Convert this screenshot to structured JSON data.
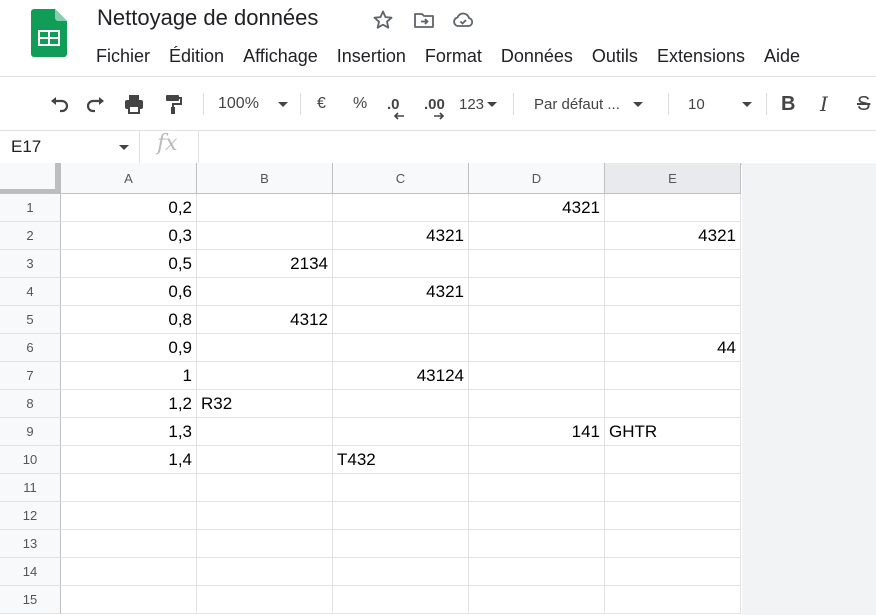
{
  "app": {
    "title": "Nettoyage de données",
    "menu": [
      "Fichier",
      "Édition",
      "Affichage",
      "Insertion",
      "Format",
      "Données",
      "Outils",
      "Extensions",
      "Aide"
    ]
  },
  "toolbar": {
    "zoom": "100%",
    "currency": "€",
    "percent": "%",
    "dec_decrease": ".0",
    "dec_increase": ".00",
    "number_format": "123",
    "font": "Par défaut ...",
    "font_size": "10",
    "bold": "B",
    "italic": "I",
    "strike": "S"
  },
  "formula_bar": {
    "name_box": "E17",
    "fx": "fx",
    "content": ""
  },
  "sheet": {
    "selected_column": "E",
    "columns": [
      "A",
      "B",
      "C",
      "D",
      "E"
    ],
    "rows": [
      "1",
      "2",
      "3",
      "4",
      "5",
      "6",
      "7",
      "8",
      "9",
      "10",
      "11",
      "12",
      "13",
      "14",
      "15"
    ],
    "cells": [
      {
        "row": 1,
        "col": "A",
        "value": "0,2",
        "type": "num"
      },
      {
        "row": 1,
        "col": "D",
        "value": "4321",
        "type": "num"
      },
      {
        "row": 2,
        "col": "A",
        "value": "0,3",
        "type": "num"
      },
      {
        "row": 2,
        "col": "C",
        "value": "4321",
        "type": "num"
      },
      {
        "row": 2,
        "col": "E",
        "value": "4321",
        "type": "num"
      },
      {
        "row": 3,
        "col": "A",
        "value": "0,5",
        "type": "num"
      },
      {
        "row": 3,
        "col": "B",
        "value": "2134",
        "type": "num"
      },
      {
        "row": 4,
        "col": "A",
        "value": "0,6",
        "type": "num"
      },
      {
        "row": 4,
        "col": "C",
        "value": "4321",
        "type": "num"
      },
      {
        "row": 5,
        "col": "A",
        "value": "0,8",
        "type": "num"
      },
      {
        "row": 5,
        "col": "B",
        "value": "4312",
        "type": "num"
      },
      {
        "row": 6,
        "col": "A",
        "value": "0,9",
        "type": "num"
      },
      {
        "row": 6,
        "col": "E",
        "value": "44",
        "type": "num"
      },
      {
        "row": 7,
        "col": "A",
        "value": "1",
        "type": "num"
      },
      {
        "row": 7,
        "col": "C",
        "value": "43124",
        "type": "num"
      },
      {
        "row": 8,
        "col": "A",
        "value": "1,2",
        "type": "num"
      },
      {
        "row": 8,
        "col": "B",
        "value": "R32",
        "type": "txt"
      },
      {
        "row": 9,
        "col": "A",
        "value": "1,3",
        "type": "num"
      },
      {
        "row": 9,
        "col": "D",
        "value": "141",
        "type": "num"
      },
      {
        "row": 9,
        "col": "E",
        "value": "GHTR",
        "type": "txt"
      },
      {
        "row": 10,
        "col": "A",
        "value": "1,4",
        "type": "num"
      },
      {
        "row": 10,
        "col": "C",
        "value": "T432",
        "type": "txt"
      }
    ]
  },
  "colors": {
    "brand_green": "#0f9d58",
    "header_bg": "#f8f9fa",
    "grid_line": "#e2e2e2"
  }
}
